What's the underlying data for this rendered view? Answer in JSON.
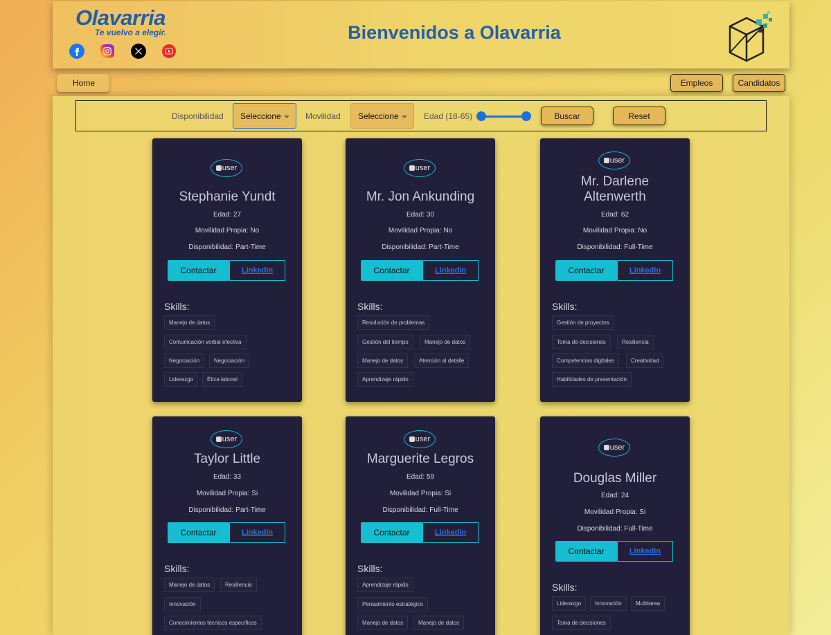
{
  "header": {
    "logo_title": "Olavarria",
    "logo_tagline": "Te vuelvo a elegir.",
    "title": "Bienvenidos a Olavarria",
    "social_icons": [
      "facebook-icon",
      "instagram-icon",
      "x-icon",
      "youtube-icon"
    ]
  },
  "nav": {
    "home": "Home",
    "empleos": "Empleos",
    "candidatos": "Candidatos"
  },
  "filters": {
    "disponibilidad_label": "Disponibilidad",
    "disponibilidad_value": "Seleccione",
    "movilidad_label": "Movilidad",
    "movilidad_value": "Seleccione",
    "edad_label": "Edad (18-65)",
    "buscar": "Buscar",
    "reset": "Reset"
  },
  "candidates": [
    {
      "avatar_alt": "user",
      "name": "Stephanie Yundt",
      "edad": "Edad: 27",
      "movilidad": "Movilidad Propia: No",
      "disponibilidad": "Disponibilidad: Part-Time",
      "contactar": "Contactar",
      "linkedin": "Linkedin",
      "skills_title": "Skills:",
      "skills": [
        "Manejo de datos",
        "Comunicación verbal efectiva",
        "Negociación",
        "Negociación",
        "Liderazgo",
        "Ética laboral"
      ]
    },
    {
      "avatar_alt": "user",
      "name": "Mr. Jon Ankunding",
      "edad": "Edad: 30",
      "movilidad": "Movilidad Propia: No",
      "disponibilidad": "Disponibilidad: Part-Time",
      "contactar": "Contactar",
      "linkedin": "Linkedin",
      "skills_title": "Skills:",
      "skills": [
        "Resolución de problemas",
        "Gestión del tiempo",
        "Manejo de datos",
        "Manejo de datos",
        "Atención al detalle",
        "Aprendizaje rápido"
      ]
    },
    {
      "avatar_alt": "user",
      "name": "Mr. Darlene Altenwerth",
      "edad": "Edad: 62",
      "movilidad": "Movilidad Propia: No",
      "disponibilidad": "Disponibilidad: Full-Time",
      "contactar": "Contactar",
      "linkedin": "Linkedin",
      "skills_title": "Skills:",
      "skills": [
        "Gestión de proyectos",
        "Toma de decisiones",
        "Resiliencia",
        "Competencias digitales",
        "Creatividad",
        "Habilidades de presentación"
      ]
    },
    {
      "avatar_alt": "user",
      "name": "Taylor Little",
      "edad": "Edad: 33",
      "movilidad": "Movilidad Propia: Si",
      "disponibilidad": "Disponibilidad: Part-Time",
      "contactar": "Contactar",
      "linkedin": "Linkedin",
      "skills_title": "Skills:",
      "skills": [
        "Manejo de datos",
        "Resiliencia",
        "Innovación",
        "Conocimientos técnicos específicos"
      ]
    },
    {
      "avatar_alt": "user",
      "name": "Marguerite Legros",
      "edad": "Edad: 59",
      "movilidad": "Movilidad Propia: Si",
      "disponibilidad": "Disponibilidad: Full-Time",
      "contactar": "Contactar",
      "linkedin": "Linkedin",
      "skills_title": "Skills:",
      "skills": [
        "Aprendizaje rápido",
        "Pensamiento estratégico",
        "Manejo de datos",
        "Manejo de datos"
      ]
    },
    {
      "avatar_alt": "user",
      "name": "Douglas Miller",
      "edad": "Edad: 24",
      "movilidad": "Movilidad Propia: Si",
      "disponibilidad": "Disponibilidad: Full-Time",
      "contactar": "Contactar",
      "linkedin": "Linkedin",
      "skills_title": "Skills:",
      "skills": [
        "Liderazgo",
        "Innovación",
        "Multitarea",
        "Toma de decisiones"
      ]
    }
  ],
  "colors": {
    "accent": "#17bdd0",
    "card_bg": "#221f3a",
    "title_blue": "#2160b0"
  }
}
